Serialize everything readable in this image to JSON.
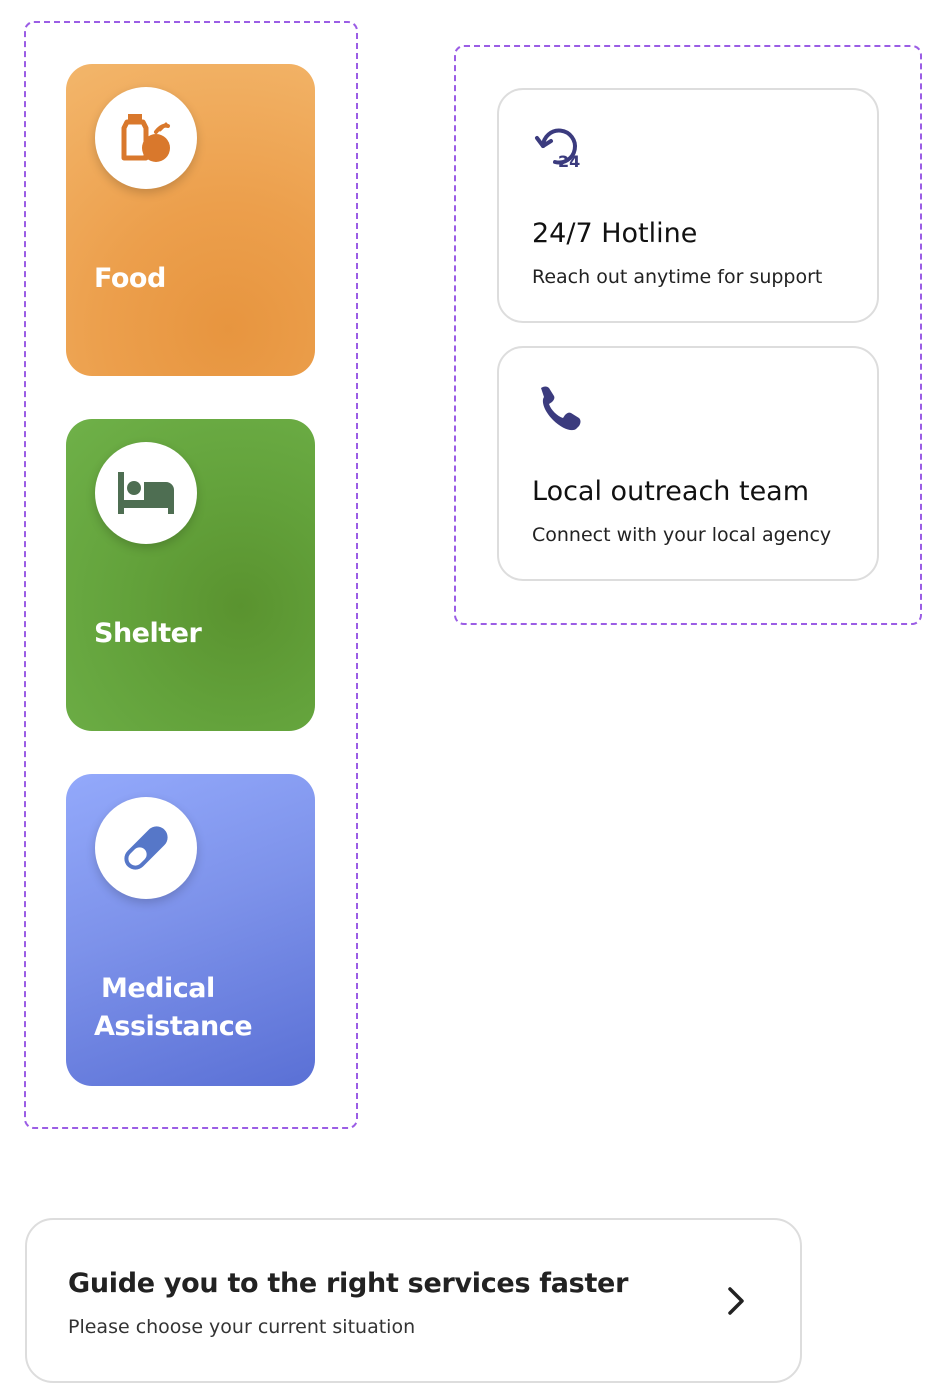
{
  "categories": {
    "food": {
      "label": "Food",
      "icon": "food-bottle-fruit-icon",
      "color": "#ed9f4c"
    },
    "shelter": {
      "label": "Shelter",
      "icon": "bed-icon",
      "color": "#66a63f"
    },
    "medical": {
      "label_line1": "Medical",
      "label_line2": "Assistance",
      "icon": "pill-capsule-icon",
      "color": "#7389e6"
    }
  },
  "contacts": {
    "hotline": {
      "title": "24/7 Hotline",
      "subtitle": "Reach out anytime for support",
      "icon": "24h-clock-icon"
    },
    "outreach": {
      "title": "Local outreach team",
      "subtitle": "Connect with your local agency",
      "icon": "phone-icon"
    }
  },
  "guide": {
    "title": "Guide you to the right services faster",
    "subtitle": "Please choose your current situation",
    "icon": "chevron-right-icon"
  },
  "colors": {
    "frame_dash": "#9b5de5",
    "icon_dark": "#3b3b7e",
    "shelter_icon": "#4e6e52",
    "food_icon": "#d9782c",
    "medical_icon": "#5677c8"
  }
}
